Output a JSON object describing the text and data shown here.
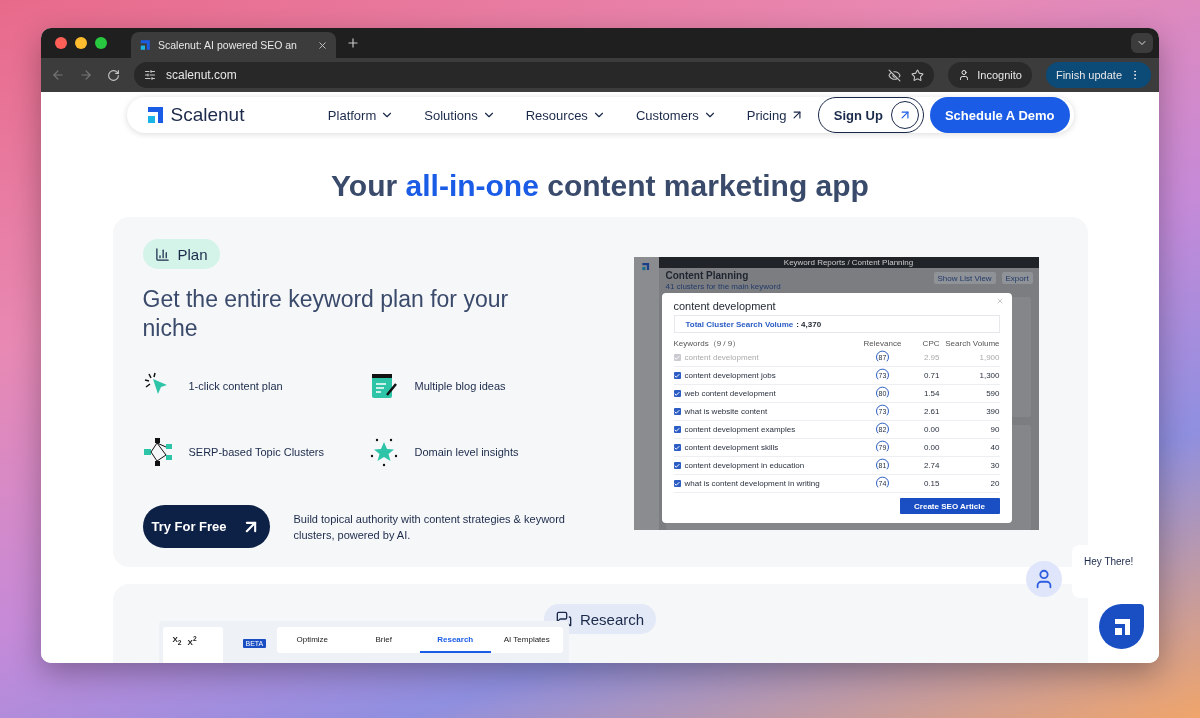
{
  "browser": {
    "tab_title": "Scalenut: AI powered SEO an",
    "url": "scalenut.com",
    "incognito_label": "Incognito",
    "update_button": "Finish update"
  },
  "nav": {
    "logo": "Scalenut",
    "items": [
      {
        "label": "Platform",
        "kind": "dropdown"
      },
      {
        "label": "Solutions",
        "kind": "dropdown"
      },
      {
        "label": "Resources",
        "kind": "dropdown"
      },
      {
        "label": "Customers",
        "kind": "dropdown"
      },
      {
        "label": "Pricing",
        "kind": "external"
      }
    ],
    "sign_up": "Sign Up",
    "demo": "Schedule A Demo"
  },
  "headline": [
    {
      "text": "Your ",
      "highlight": false
    },
    {
      "text": "all-in-one",
      "highlight": true
    },
    {
      "text": " content marketing app",
      "highlight": false
    }
  ],
  "plan": {
    "badge": "Plan",
    "heading": "Get the entire keyword plan for your niche",
    "features": [
      {
        "label": "1-click content plan",
        "kind": "click"
      },
      {
        "label": "Multiple blog ideas",
        "kind": "blog"
      },
      {
        "label": "SERP-based Topic Clusters",
        "kind": "cluster"
      },
      {
        "label": "Domain level insights",
        "kind": "star"
      }
    ],
    "cta": "Try For Free",
    "tagline": "Build topical authority with content strategies & keyword clusters, powered by AI.",
    "app": {
      "breadcrumb": "Keyword Reports / Content Planning",
      "title": "Content Planning",
      "subtitle": "41 clusters for the main keyword",
      "list_view": "Show List View",
      "export": "Export",
      "modal": {
        "title": "content development",
        "volume_label": "Total Cluster Search Volume",
        "volume_value": ": 4,370",
        "columns": [
          "Keywords（9 / 9）",
          "Relevance",
          "CPC",
          "Search Volume"
        ],
        "rows": [
          {
            "keyword": "content development",
            "checked": true,
            "disabled": true,
            "relevance": "87",
            "cpc": "2.95",
            "volume": "1,900"
          },
          {
            "keyword": "content development jobs",
            "checked": true,
            "disabled": false,
            "relevance": "73",
            "cpc": "0.71",
            "volume": "1,300"
          },
          {
            "keyword": "web content development",
            "checked": true,
            "disabled": false,
            "relevance": "80",
            "cpc": "1.54",
            "volume": "590"
          },
          {
            "keyword": "what is website content",
            "checked": true,
            "disabled": false,
            "relevance": "73",
            "cpc": "2.61",
            "volume": "390"
          },
          {
            "keyword": "content development examples",
            "checked": true,
            "disabled": false,
            "relevance": "82",
            "cpc": "0.00",
            "volume": "90"
          },
          {
            "keyword": "content development skills",
            "checked": true,
            "disabled": false,
            "relevance": "79",
            "cpc": "0.00",
            "volume": "40"
          },
          {
            "keyword": "content development in education",
            "checked": true,
            "disabled": false,
            "relevance": "81",
            "cpc": "2.74",
            "volume": "30"
          },
          {
            "keyword": "what is content development in writing",
            "checked": true,
            "disabled": false,
            "relevance": "74",
            "cpc": "0.15",
            "volume": "20"
          }
        ],
        "button": "Create SEO Article"
      }
    }
  },
  "research": {
    "badge": "Research",
    "editor": {
      "format_marks": [
        "X$_{2}$",
        "X$^{2}$"
      ],
      "beta": "BETA",
      "tabs": [
        {
          "label": "Optimize",
          "selected": false
        },
        {
          "label": "Brief",
          "selected": false
        },
        {
          "label": "Research",
          "selected": true
        },
        {
          "label": "AI Templates",
          "selected": false
        }
      ]
    }
  },
  "chat": {
    "greeting": "Hey There!"
  }
}
